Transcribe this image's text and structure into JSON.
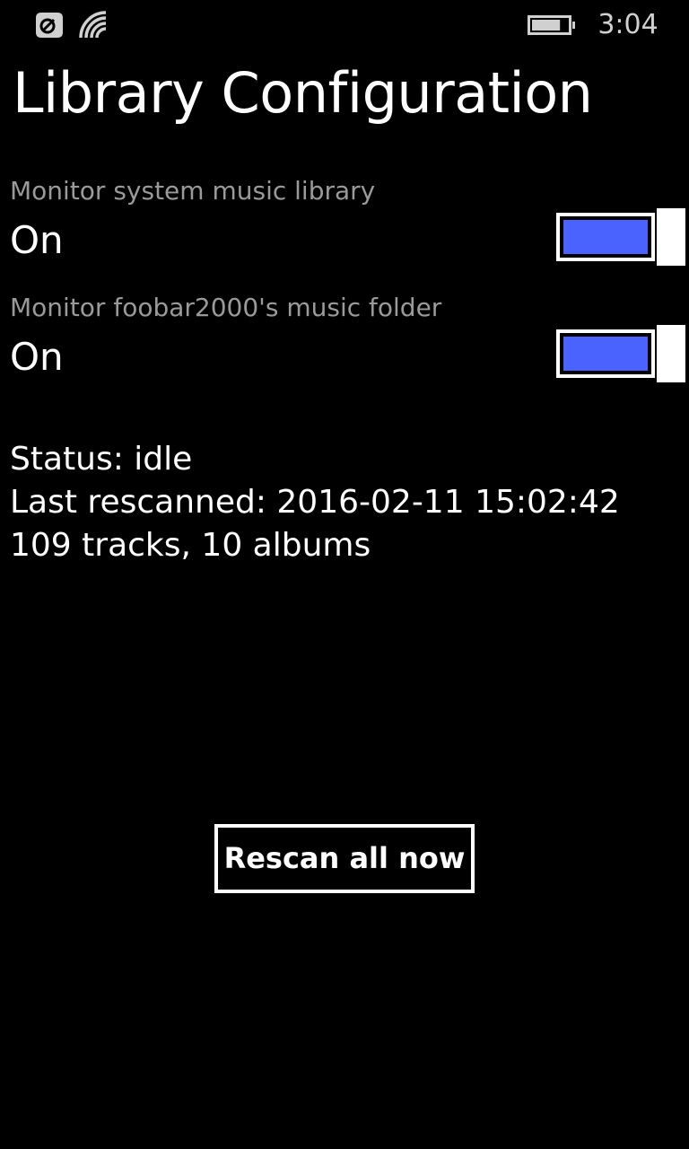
{
  "status_bar": {
    "time": "3:04",
    "icons": [
      "nfc-icon",
      "wifi-icon",
      "battery-icon"
    ],
    "battery_level": 0.8
  },
  "page": {
    "title": "Library Configuration"
  },
  "settings": [
    {
      "label": "Monitor system music library",
      "value": "On",
      "enabled": true
    },
    {
      "label": "Monitor foobar2000's music folder",
      "value": "On",
      "enabled": true
    }
  ],
  "info": {
    "status": "Status: idle",
    "last_rescanned": "Last rescanned: 2016-02-11 15:02:42",
    "counts": "109 tracks, 10 albums"
  },
  "actions": {
    "rescan_label": "Rescan all now"
  },
  "colors": {
    "background": "#000000",
    "accent": "#4a63ff",
    "label": "#9a9a9a",
    "text": "#ffffff"
  }
}
